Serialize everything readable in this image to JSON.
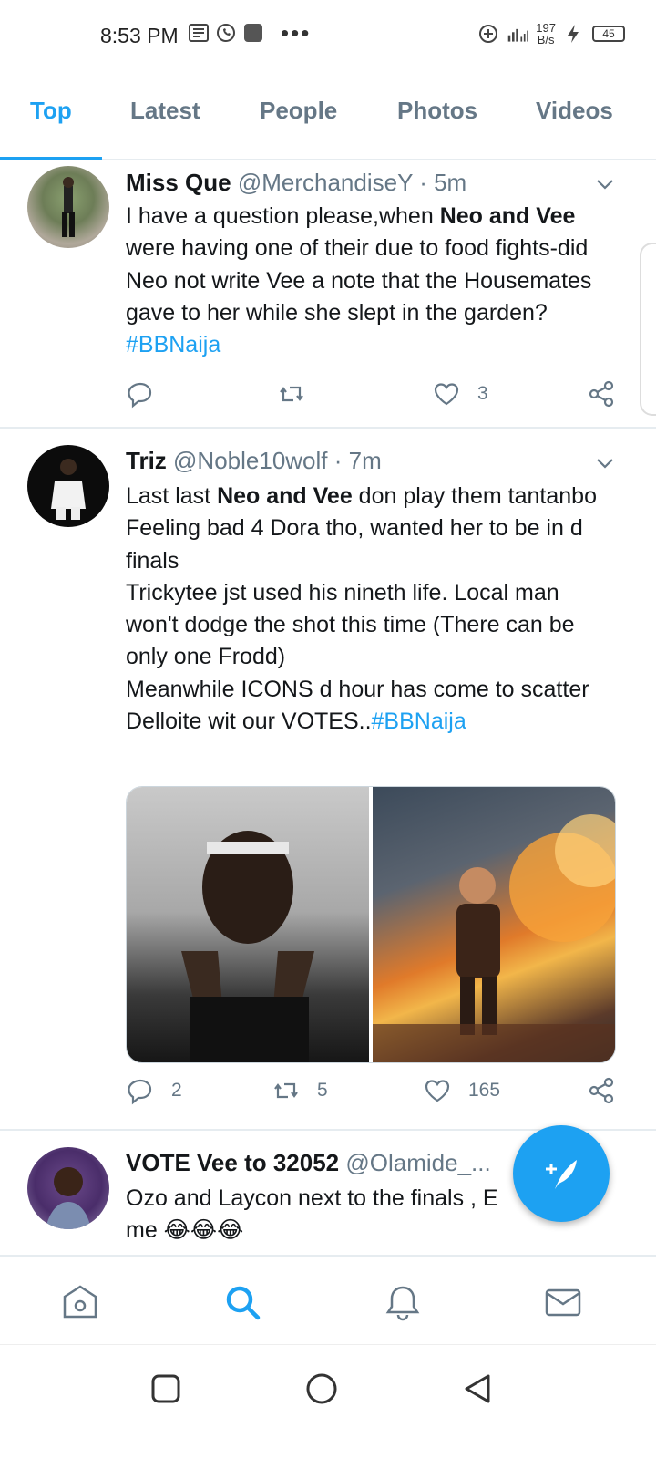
{
  "status_bar": {
    "time": "8:53 PM",
    "speed_value": "197",
    "speed_unit": "B/s",
    "battery": "45",
    "dots": "•••"
  },
  "tabs": [
    {
      "label": "Top",
      "active": true
    },
    {
      "label": "Latest",
      "active": false
    },
    {
      "label": "People",
      "active": false
    },
    {
      "label": "Photos",
      "active": false
    },
    {
      "label": "Videos",
      "active": false
    }
  ],
  "tweets": [
    {
      "name": "Miss Que",
      "handle": "@MerchandiseY",
      "sep": "·",
      "time": "5m",
      "text_parts": [
        "I have a question please,when ",
        "Neo and Vee",
        " were having one of their due to food fights-did Neo not write Vee a note that the Housemates gave to her while she slept in the garden? ",
        "#BBNaija"
      ],
      "replies": "",
      "retweets": "",
      "likes": "3"
    },
    {
      "name": "Triz",
      "handle": "@Noble10wolf",
      "sep": "·",
      "time": "7m",
      "text_lines": [
        [
          "Last last ",
          "Neo and Vee",
          " don play them tantanbo"
        ],
        "Feeling bad 4 Dora tho, wanted her to be in d finals",
        "Trickytee jst used his nineth life. Local man won't dodge the shot this time (There can be only one Frodd)",
        [
          "Meanwhile ICONS d hour has come to scatter Delloite wit our VOTES..",
          "#BBNaija"
        ]
      ],
      "replies": "2",
      "retweets": "5",
      "likes": "165"
    },
    {
      "name": "VOTE Vee to 32052",
      "handle": "@Olamide_...",
      "text": "Ozo and Laycon next to the finals , E",
      "text2": "me 😂😂😂"
    }
  ],
  "colors": {
    "accent": "#1da1f2",
    "muted": "#657786",
    "text": "#14171a"
  }
}
